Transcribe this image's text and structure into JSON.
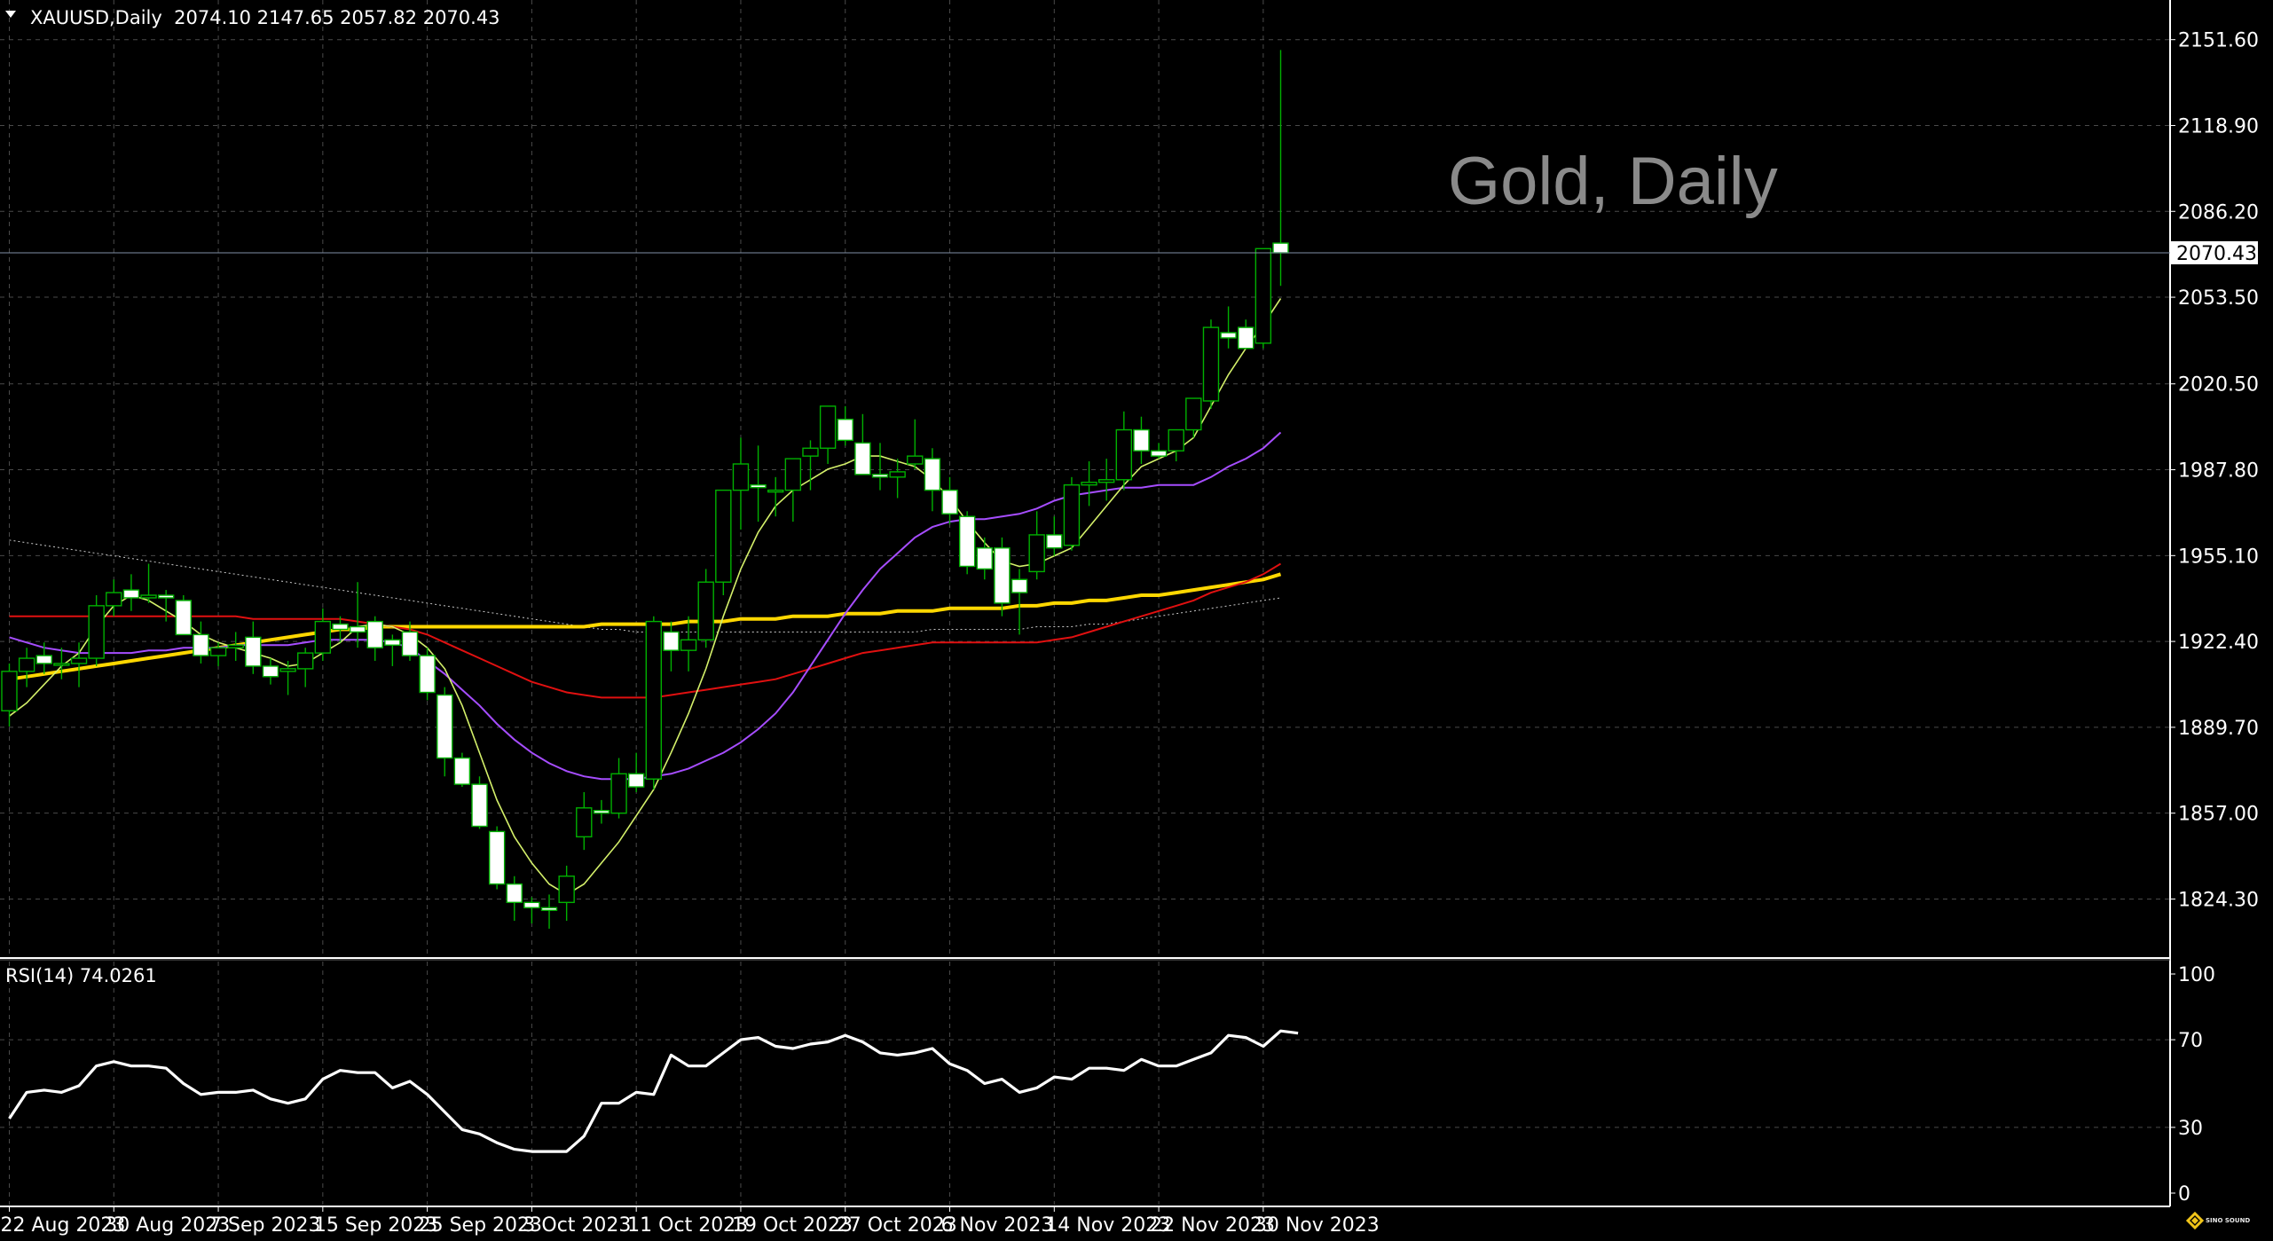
{
  "header": {
    "symbol_line": "XAUUSD,Daily  2074.10 2147.65 2057.82 2070.43",
    "watermark": "Gold, Daily",
    "current_price": "2070.43",
    "rsi_label": "RSI(14) 74.0261",
    "brand": "SINO SOUND"
  },
  "colors": {
    "background": "#000000",
    "grid": "#4a4a4a",
    "bull_candle": "#00b000",
    "bear_candle_body": "#ffffff",
    "ma5": "#d4f06a",
    "ma20": "#a64dff",
    "ma50": "#e01010",
    "ma100": "#ffd700",
    "ma200": "#c8c8c8",
    "rsi": "#ffffff"
  },
  "chart_data": [
    {
      "type": "candlestick",
      "symbol": "XAUUSD",
      "timeframe": "Daily",
      "y_ticks": [
        2151.6,
        2118.9,
        2086.2,
        2053.5,
        2020.5,
        1987.8,
        1955.1,
        1922.4,
        1889.7,
        1857.0,
        1824.3
      ],
      "ylim": [
        1802.5,
        2166.7
      ],
      "x_labels": [
        {
          "label": "22 Aug 2023",
          "index": 0
        },
        {
          "label": "30 Aug 2023",
          "index": 6
        },
        {
          "label": "7 Sep 2023",
          "index": 12
        },
        {
          "label": "15 Sep 2023",
          "index": 18
        },
        {
          "label": "25 Sep 2023",
          "index": 24
        },
        {
          "label": "3 Oct 2023",
          "index": 30
        },
        {
          "label": "11 Oct 2023",
          "index": 36
        },
        {
          "label": "19 Oct 2023",
          "index": 42
        },
        {
          "label": "27 Oct 2023",
          "index": 48
        },
        {
          "label": "6 Nov 2023",
          "index": 54
        },
        {
          "label": "14 Nov 2023",
          "index": 60
        },
        {
          "label": "22 Nov 2023",
          "index": 66
        },
        {
          "label": "30 Nov 2023",
          "index": 72
        }
      ],
      "candles": [
        [
          1896,
          1914,
          1890,
          1911
        ],
        [
          1911,
          1920,
          1905,
          1916
        ],
        [
          1917,
          1922,
          1910,
          1914
        ],
        [
          1914,
          1920,
          1908,
          1914
        ],
        [
          1914,
          1922,
          1905,
          1916
        ],
        [
          1916,
          1940,
          1913,
          1936
        ],
        [
          1936,
          1946,
          1932,
          1941
        ],
        [
          1942,
          1948,
          1934,
          1939
        ],
        [
          1939,
          1952,
          1937,
          1940
        ],
        [
          1940,
          1942,
          1930,
          1939
        ],
        [
          1938,
          1940,
          1925,
          1925
        ],
        [
          1925,
          1930,
          1914,
          1917
        ],
        [
          1917,
          1922,
          1913,
          1920
        ],
        [
          1920,
          1926,
          1915,
          1921
        ],
        [
          1924,
          1930,
          1910,
          1913
        ],
        [
          1913,
          1916,
          1906,
          1909
        ],
        [
          1911,
          1915,
          1902,
          1912
        ],
        [
          1912,
          1920,
          1905,
          1918
        ],
        [
          1918,
          1935,
          1915,
          1930
        ],
        [
          1929,
          1932,
          1922,
          1927
        ],
        [
          1928,
          1945,
          1920,
          1926
        ],
        [
          1930,
          1932,
          1915,
          1920
        ],
        [
          1923,
          1925,
          1913,
          1921
        ],
        [
          1926,
          1930,
          1915,
          1917
        ],
        [
          1917,
          1920,
          1900,
          1903
        ],
        [
          1902,
          1905,
          1871,
          1878
        ],
        [
          1878,
          1880,
          1867,
          1868
        ],
        [
          1868,
          1871,
          1851,
          1852
        ],
        [
          1850,
          1852,
          1828,
          1830
        ],
        [
          1830,
          1833,
          1816,
          1823
        ],
        [
          1823,
          1825,
          1815,
          1821
        ],
        [
          1821,
          1826,
          1813,
          1820
        ],
        [
          1823,
          1837,
          1816,
          1833
        ],
        [
          1848,
          1865,
          1843,
          1859
        ],
        [
          1858,
          1862,
          1853,
          1857
        ],
        [
          1857,
          1878,
          1855,
          1872
        ],
        [
          1872,
          1880,
          1865,
          1867
        ],
        [
          1870,
          1932,
          1866,
          1930
        ],
        [
          1926,
          1930,
          1911,
          1919
        ],
        [
          1919,
          1932,
          1911,
          1923
        ],
        [
          1923,
          1950,
          1920,
          1945
        ],
        [
          1945,
          1978,
          1940,
          1980
        ],
        [
          1980,
          2000,
          1965,
          1990
        ],
        [
          1982,
          1997,
          1968,
          1981
        ],
        [
          1980,
          1985,
          1970,
          1980
        ],
        [
          1980,
          1990,
          1968,
          1992
        ],
        [
          1993,
          1999,
          1980,
          1996
        ],
        [
          1996,
          2012,
          1990,
          2012
        ],
        [
          2007,
          2012,
          1997,
          1999
        ],
        [
          1998,
          2009,
          1989,
          1986
        ],
        [
          1986,
          1998,
          1980,
          1985
        ],
        [
          1985,
          1992,
          1977,
          1987
        ],
        [
          1990,
          2007,
          1988,
          1993
        ],
        [
          1992,
          1996,
          1972,
          1980
        ],
        [
          1980,
          1985,
          1967,
          1971
        ],
        [
          1970,
          1972,
          1948,
          1951
        ],
        [
          1958,
          1962,
          1946,
          1950
        ],
        [
          1958,
          1962,
          1932,
          1937
        ],
        [
          1946,
          1950,
          1925,
          1941
        ],
        [
          1949,
          1972,
          1946,
          1963
        ],
        [
          1963,
          1970,
          1955,
          1958
        ],
        [
          1959,
          1985,
          1957,
          1982
        ],
        [
          1982,
          1991,
          1974,
          1983
        ],
        [
          1983,
          1992,
          1976,
          1984
        ],
        [
          1984,
          2010,
          1980,
          2003
        ],
        [
          2003,
          2008,
          1990,
          1995
        ],
        [
          1995,
          1998,
          1992,
          1993
        ],
        [
          1995,
          2002,
          1991,
          2003
        ],
        [
          2003,
          2015,
          2000,
          2015
        ],
        [
          2014,
          2045,
          2011,
          2042
        ],
        [
          2040,
          2050,
          2034,
          2038
        ],
        [
          2042,
          2045,
          2034,
          2034
        ],
        [
          2036,
          2072,
          2034,
          2072
        ],
        [
          2074.1,
          2147.65,
          2057.82,
          2070.43
        ]
      ],
      "ma5": [
        1894,
        1899,
        1906,
        1913,
        1918,
        1928,
        1936,
        1940,
        1938,
        1934,
        1930,
        1925,
        1922,
        1920,
        1918,
        1916,
        1913,
        1914,
        1918,
        1922,
        1928,
        1929,
        1928,
        1925,
        1920,
        1912,
        1898,
        1880,
        1862,
        1848,
        1838,
        1830,
        1826,
        1830,
        1838,
        1846,
        1856,
        1866,
        1880,
        1895,
        1912,
        1932,
        1950,
        1964,
        1974,
        1980,
        1984,
        1988,
        1990,
        1993,
        1993,
        1991,
        1989,
        1984,
        1977,
        1968,
        1960,
        1953,
        1951,
        1952,
        1955,
        1958,
        1966,
        1974,
        1982,
        1989,
        1992,
        1995,
        2000,
        2012,
        2024,
        2034,
        2043,
        2053
      ],
      "ma20": [
        1924,
        1922,
        1920,
        1919,
        1918,
        1918,
        1918,
        1918,
        1919,
        1919,
        1920,
        1920,
        1920,
        1921,
        1921,
        1921,
        1921,
        1922,
        1923,
        1923,
        1923,
        1923,
        1922,
        1920,
        1915,
        1910,
        1904,
        1898,
        1891,
        1885,
        1880,
        1876,
        1873,
        1871,
        1870,
        1870,
        1870,
        1871,
        1872,
        1874,
        1877,
        1880,
        1884,
        1889,
        1895,
        1903,
        1913,
        1923,
        1933,
        1942,
        1950,
        1956,
        1962,
        1966,
        1968,
        1969,
        1969,
        1970,
        1971,
        1973,
        1976,
        1978,
        1979,
        1980,
        1981,
        1981,
        1982,
        1982,
        1982,
        1985,
        1989,
        1992,
        1996,
        2002
      ],
      "ma50": [
        1932,
        1932,
        1932,
        1932,
        1932,
        1932,
        1932,
        1932,
        1932,
        1932,
        1932,
        1932,
        1932,
        1932,
        1931,
        1931,
        1931,
        1931,
        1931,
        1931,
        1930,
        1929,
        1928,
        1927,
        1925,
        1922,
        1919,
        1916,
        1913,
        1910,
        1907,
        1905,
        1903,
        1902,
        1901,
        1901,
        1901,
        1901,
        1902,
        1903,
        1904,
        1905,
        1906,
        1907,
        1908,
        1910,
        1912,
        1914,
        1916,
        1918,
        1919,
        1920,
        1921,
        1922,
        1922,
        1922,
        1922,
        1922,
        1922,
        1922,
        1923,
        1924,
        1926,
        1928,
        1930,
        1932,
        1934,
        1936,
        1938,
        1941,
        1943,
        1945,
        1948,
        1952
      ],
      "ma100": [
        1908,
        1909,
        1910,
        1911,
        1912,
        1913,
        1914,
        1915,
        1916,
        1917,
        1918,
        1919,
        1920,
        1921,
        1922,
        1923,
        1924,
        1925,
        1926,
        1927,
        1927,
        1928,
        1928,
        1928,
        1928,
        1928,
        1928,
        1928,
        1928,
        1928,
        1928,
        1928,
        1928,
        1928,
        1929,
        1929,
        1929,
        1929,
        1929,
        1930,
        1930,
        1930,
        1931,
        1931,
        1931,
        1932,
        1932,
        1932,
        1933,
        1933,
        1933,
        1934,
        1934,
        1934,
        1935,
        1935,
        1935,
        1935,
        1936,
        1936,
        1937,
        1937,
        1938,
        1938,
        1939,
        1940,
        1940,
        1941,
        1942,
        1943,
        1944,
        1945,
        1946,
        1948
      ],
      "ma200": [
        1961,
        1960,
        1959,
        1958,
        1957,
        1956,
        1955,
        1954,
        1953,
        1952,
        1951,
        1950,
        1949,
        1948,
        1947,
        1946,
        1945,
        1944,
        1943,
        1942,
        1941,
        1940,
        1939,
        1938,
        1937,
        1936,
        1935,
        1934,
        1933,
        1932,
        1931,
        1930,
        1929,
        1928,
        1927,
        1927,
        1926,
        1926,
        1926,
        1926,
        1926,
        1926,
        1926,
        1926,
        1926,
        1926,
        1926,
        1926,
        1926,
        1926,
        1926,
        1926,
        1926,
        1927,
        1927,
        1927,
        1927,
        1927,
        1927,
        1928,
        1928,
        1928,
        1929,
        1929,
        1930,
        1931,
        1932,
        1933,
        1934,
        1935,
        1936,
        1937,
        1938,
        1939
      ]
    },
    {
      "type": "line",
      "name": "RSI(14)",
      "ylim": [
        0,
        100
      ],
      "y_ticks": [
        100,
        70,
        30,
        0
      ],
      "values": [
        34,
        46,
        47,
        46,
        49,
        58,
        60,
        58,
        58,
        57,
        50,
        45,
        46,
        46,
        47,
        43,
        41,
        43,
        52,
        56,
        55,
        55,
        48,
        51,
        45,
        37,
        29,
        27,
        23,
        20,
        19,
        19,
        19,
        26,
        41,
        41,
        46,
        45,
        63,
        58,
        58,
        64,
        70,
        71,
        67,
        66,
        68,
        69,
        72,
        69,
        64,
        63,
        64,
        66,
        59,
        56,
        50,
        52,
        46,
        48,
        53,
        52,
        57,
        57,
        56,
        61,
        58,
        58,
        61,
        64,
        72,
        71,
        67,
        74.0261,
        73
      ]
    }
  ]
}
